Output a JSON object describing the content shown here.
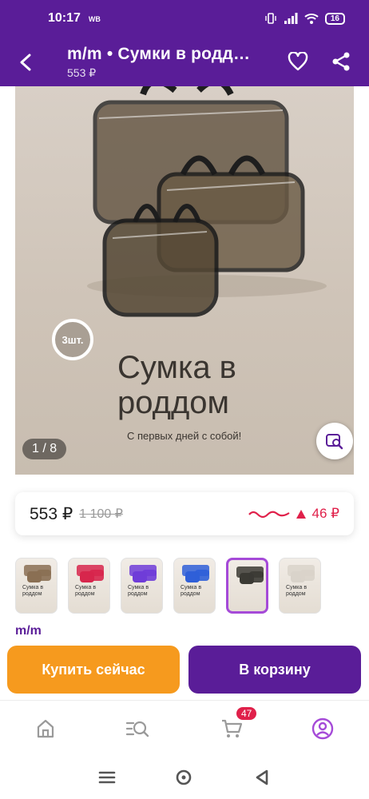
{
  "status_bar": {
    "time": "10:17",
    "carrier": "WB",
    "battery": "16"
  },
  "header": {
    "title": "m/m • Сумки в родд…",
    "price": "553 ₽"
  },
  "image": {
    "badge": "3шт.",
    "title_line1": "Сумка в",
    "title_line2": "роддом",
    "subtitle": "С первых дней с собой!",
    "counter": "1 / 8"
  },
  "price_card": {
    "current": "553 ₽",
    "old": "1 100 ₽",
    "change": "46 ₽"
  },
  "thumbnails": [
    {
      "color": "#8a6f53",
      "label": "Сумка в роддом",
      "selected": false
    },
    {
      "color": "#d7264c",
      "label": "Сумка в роддом",
      "selected": false
    },
    {
      "color": "#6f3cd8",
      "label": "Сумка в роддом",
      "selected": false
    },
    {
      "color": "#2f5fd8",
      "label": "Сумка в роддом",
      "selected": false
    },
    {
      "color": "#3b3a34",
      "label": "",
      "selected": true
    },
    {
      "color": "#d9d3ca",
      "label": "Сумка в роддом",
      "selected": false
    }
  ],
  "brand": "m/m",
  "buttons": {
    "buy_now": "Купить сейчас",
    "to_cart": "В корзину"
  },
  "bottom_nav": {
    "cart_count": "47"
  },
  "colors": {
    "primary": "#5a1d98",
    "accent": "#f69a1e",
    "price_up": "#e0204a"
  }
}
